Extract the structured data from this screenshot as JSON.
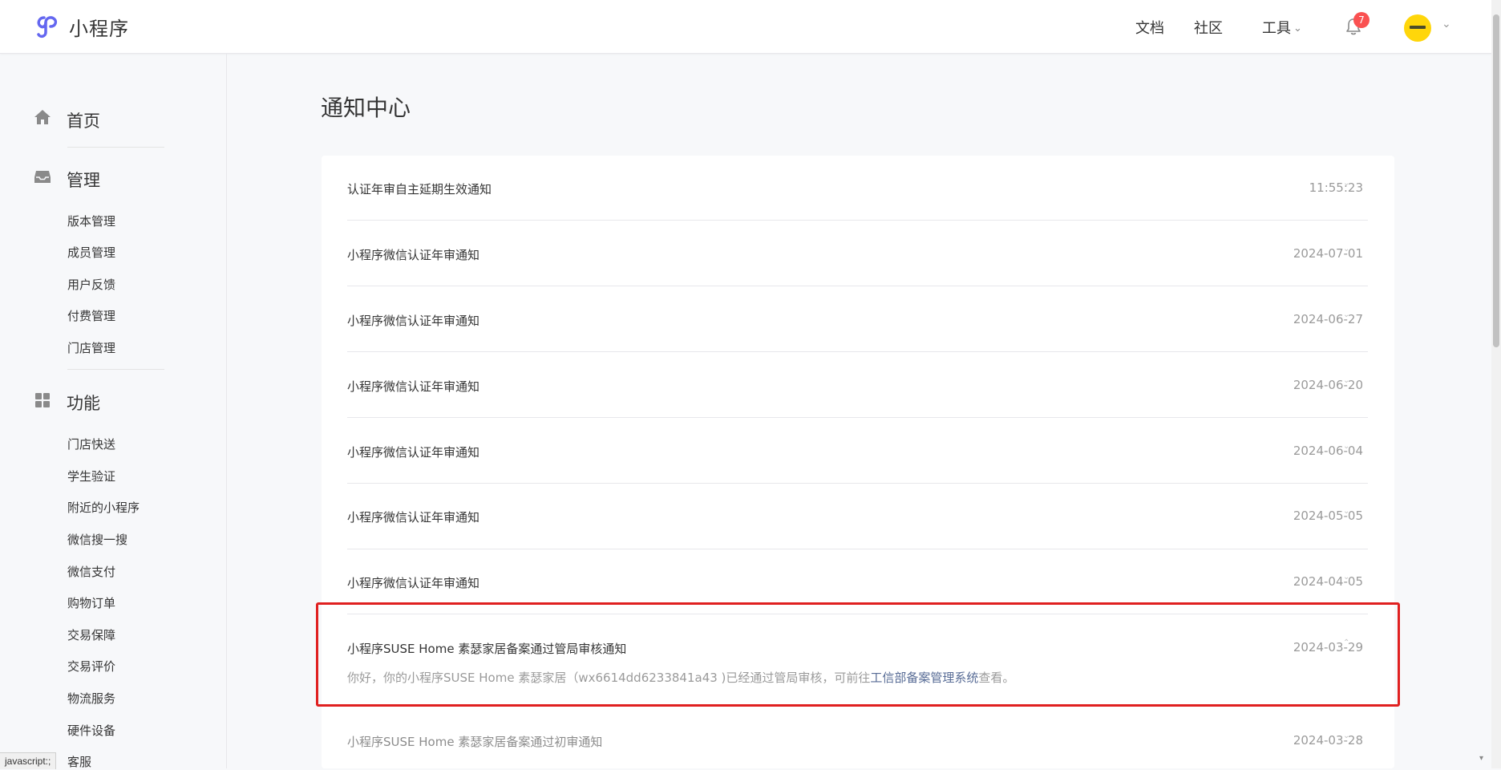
{
  "header": {
    "brand": "小程序",
    "nav": {
      "docs": "文档",
      "community": "社区",
      "tools": "工具"
    },
    "notification_count": "7",
    "accent_color": "#6467f0"
  },
  "sidebar": {
    "home": "首页",
    "manage": "管理",
    "manage_items": [
      "版本管理",
      "成员管理",
      "用户反馈",
      "付费管理",
      "门店管理"
    ],
    "features": "功能",
    "feature_items": [
      "门店快送",
      "学生验证",
      "附近的小程序",
      "微信搜一搜",
      "微信支付",
      "购物订单",
      "交易保障",
      "交易评价",
      "物流服务",
      "硬件设备",
      "客服"
    ]
  },
  "main": {
    "title": "通知中心",
    "notifications": [
      {
        "title": "认证年审自主延期生效通知",
        "date": "11:55:23"
      },
      {
        "title": "小程序微信认证年审通知",
        "date": "2024-07-01"
      },
      {
        "title": "小程序微信认证年审通知",
        "date": "2024-06-27"
      },
      {
        "title": "小程序微信认证年审通知",
        "date": "2024-06-20"
      },
      {
        "title": "小程序微信认证年审通知",
        "date": "2024-06-04"
      },
      {
        "title": "小程序微信认证年审通知",
        "date": "2024-05-05"
      },
      {
        "title": "小程序微信认证年审通知",
        "date": "2024-04-05"
      },
      {
        "title": "小程序SUSE Home 素瑟家居备案通过管局审核通知",
        "date": "2024-03-29"
      },
      {
        "title": "小程序SUSE Home 素瑟家居备案通过初审通知",
        "date": "2024-03-28"
      }
    ],
    "expanded_detail": {
      "prefix": "你好，你的小程序SUSE Home 素瑟家居（wx6614dd6233841a43 )已经通过管局审核，可前往",
      "link": "工信部备案管理系统",
      "suffix": "查看。"
    }
  },
  "status_bar": {
    "url": "javascript:;"
  }
}
